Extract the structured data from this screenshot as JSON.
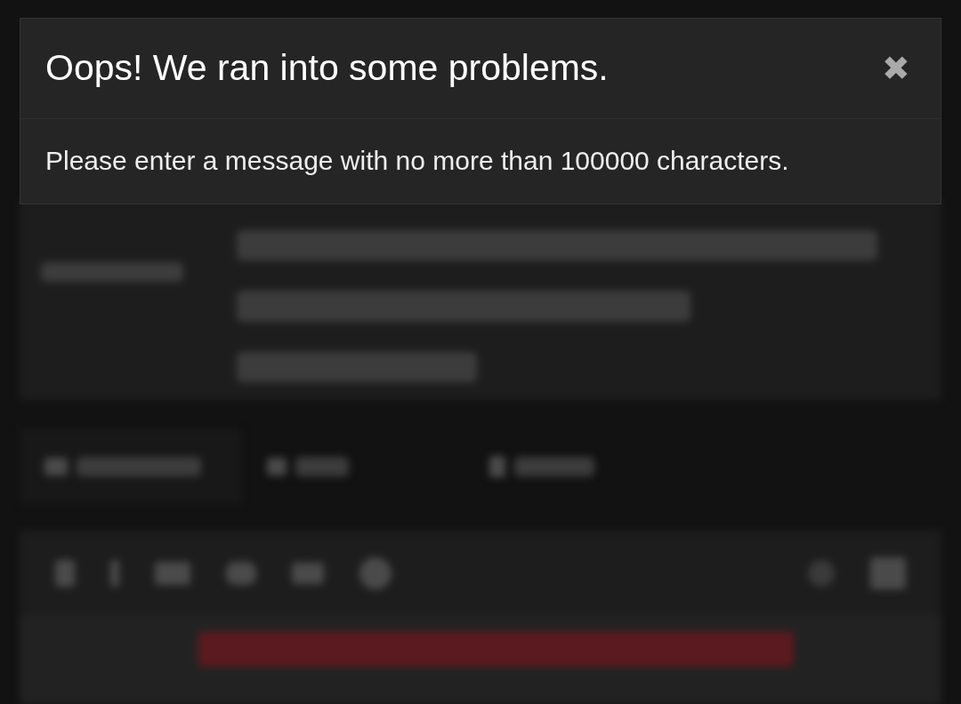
{
  "dialog": {
    "title": "Oops! We ran into some problems.",
    "close": "✖",
    "message": "Please enter a message with no more than 100000 characters."
  }
}
